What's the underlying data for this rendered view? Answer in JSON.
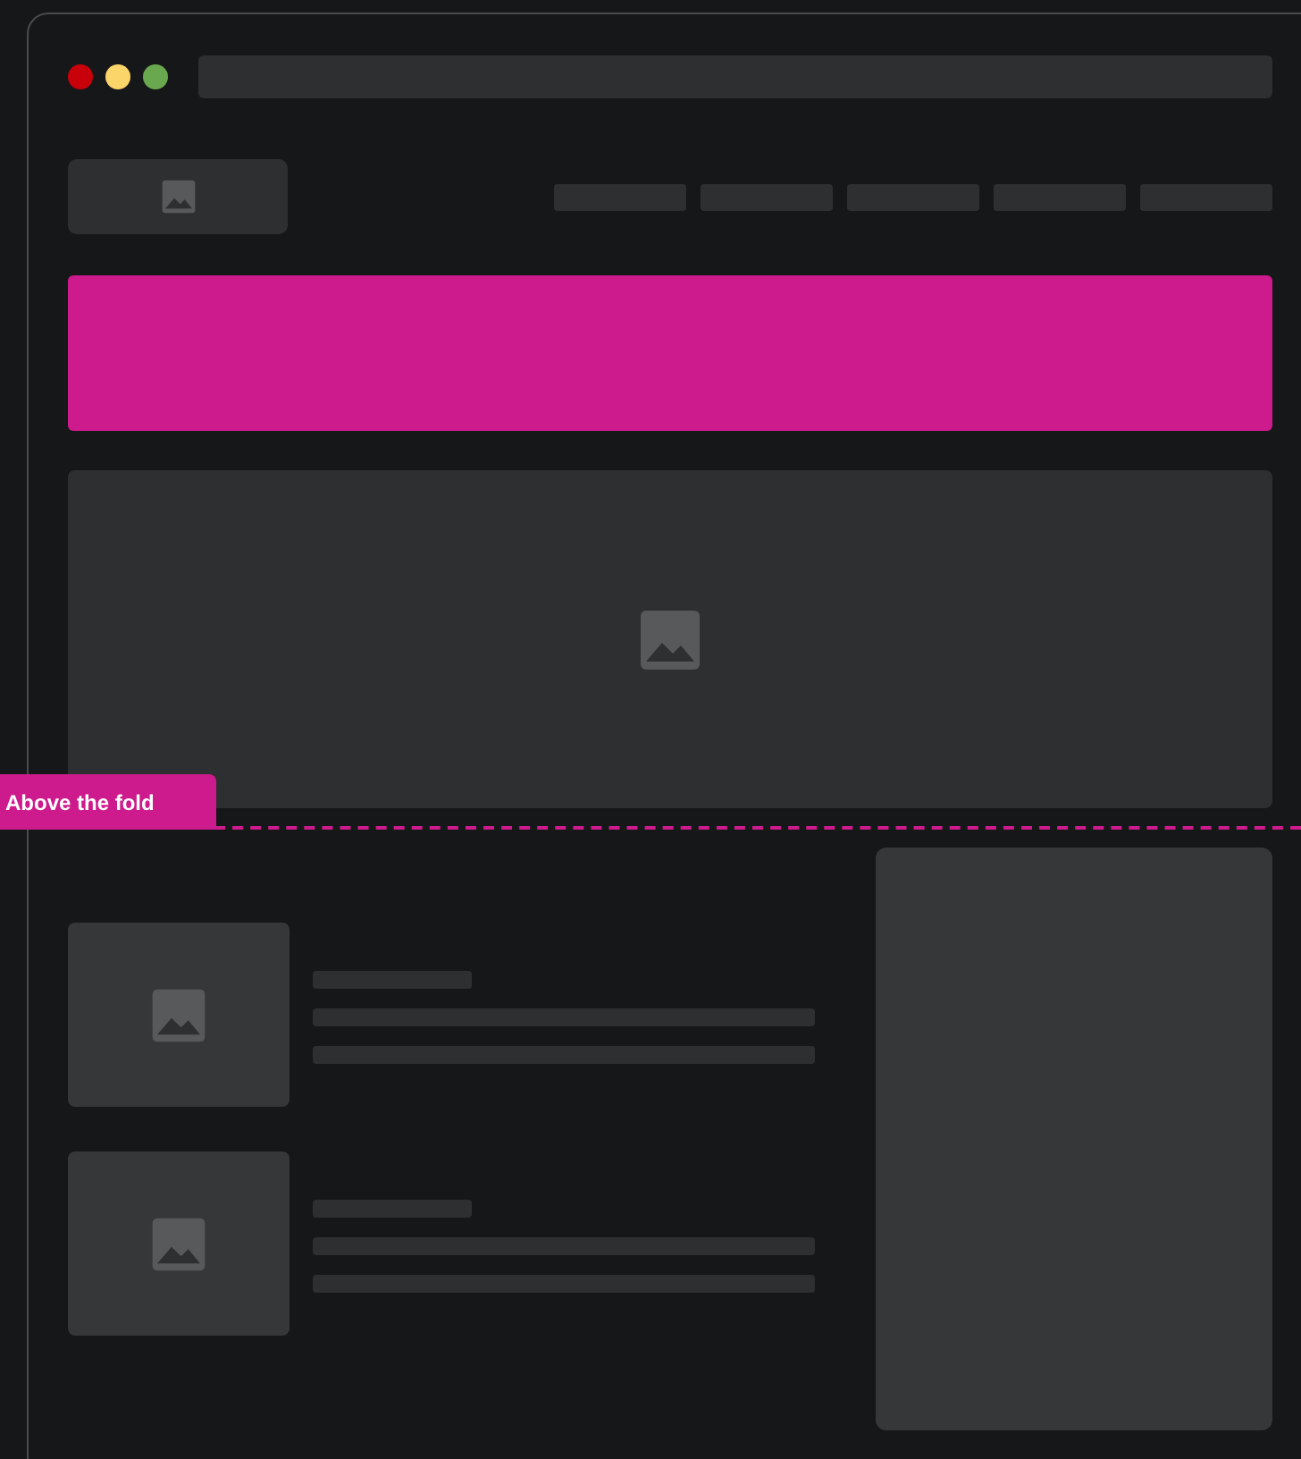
{
  "fold_label": {
    "text": "Above the fold"
  }
}
